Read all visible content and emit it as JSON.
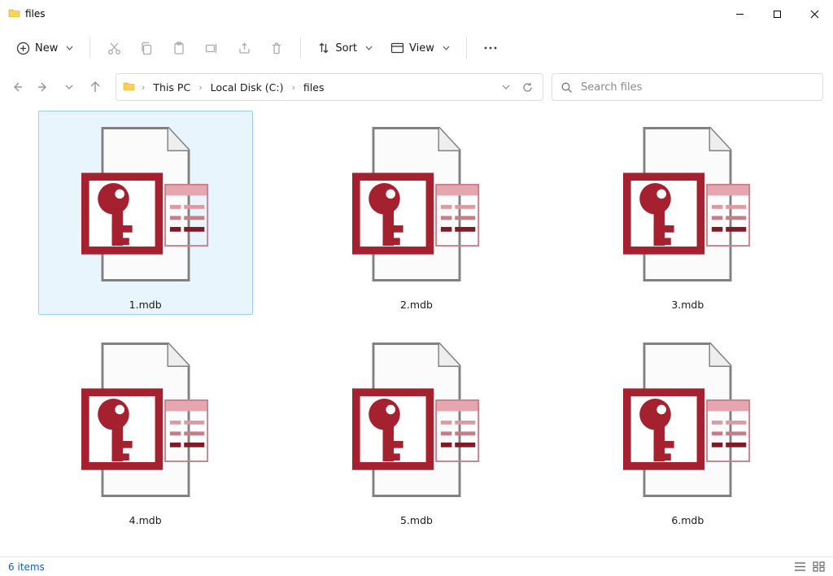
{
  "window": {
    "title": "files"
  },
  "toolbar": {
    "new_label": "New",
    "sort_label": "Sort",
    "view_label": "View"
  },
  "breadcrumb": [
    "This PC",
    "Local Disk (C:)",
    "files"
  ],
  "search": {
    "placeholder": "Search files"
  },
  "files": [
    {
      "name": "1.mdb",
      "selected": true
    },
    {
      "name": "2.mdb",
      "selected": false
    },
    {
      "name": "3.mdb",
      "selected": false
    },
    {
      "name": "4.mdb",
      "selected": false
    },
    {
      "name": "5.mdb",
      "selected": false
    },
    {
      "name": "6.mdb",
      "selected": false
    }
  ],
  "status": {
    "count_label": "6 items"
  }
}
